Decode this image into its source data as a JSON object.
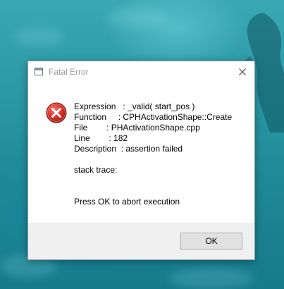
{
  "window": {
    "title": "Fatal Error",
    "title_icon": "application-window-icon",
    "close_icon": "close-icon"
  },
  "message": {
    "icon": "error-icon",
    "rows": [
      {
        "key": "Expression",
        "sep": "   : ",
        "value": "_valid( start_pos )"
      },
      {
        "key": "Function",
        "sep": "     : ",
        "value": "CPHActivationShape::Create"
      },
      {
        "key": "File",
        "sep": "        : ",
        "value": "PHActivationShape.cpp"
      },
      {
        "key": "Line",
        "sep": "        : ",
        "value": "182"
      },
      {
        "key": "Description",
        "sep": "  : ",
        "value": "assertion failed"
      }
    ],
    "stack_trace": "stack trace:",
    "prompt": "Press OK to abort execution"
  },
  "buttons": {
    "ok_label": "OK"
  },
  "colors": {
    "water_top": "#3aa9b4",
    "water_bottom": "#167a8b",
    "error_red": "#d9312a",
    "dialog_footer": "#f0f0f0"
  }
}
